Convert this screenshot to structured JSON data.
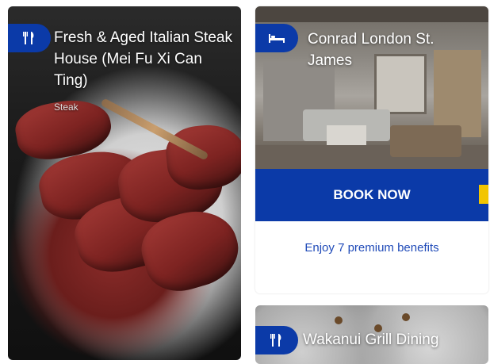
{
  "cards": [
    {
      "title": "Fresh & Aged Italian Steak House (Mei Fu Xi Can Ting)",
      "cuisine": "Steak",
      "icon": "fork-knife-icon"
    },
    {
      "title": "Conrad London St. James",
      "icon": "bed-icon",
      "button": "BOOK NOW",
      "link": "Enjoy 7 premium benefits"
    },
    {
      "title": "Wakanui Grill Dining",
      "icon": "fork-knife-icon"
    }
  ],
  "colors": {
    "brand_blue": "#0b3aa8",
    "accent_yellow": "#f2c500",
    "link_blue": "#1f4ab8"
  }
}
